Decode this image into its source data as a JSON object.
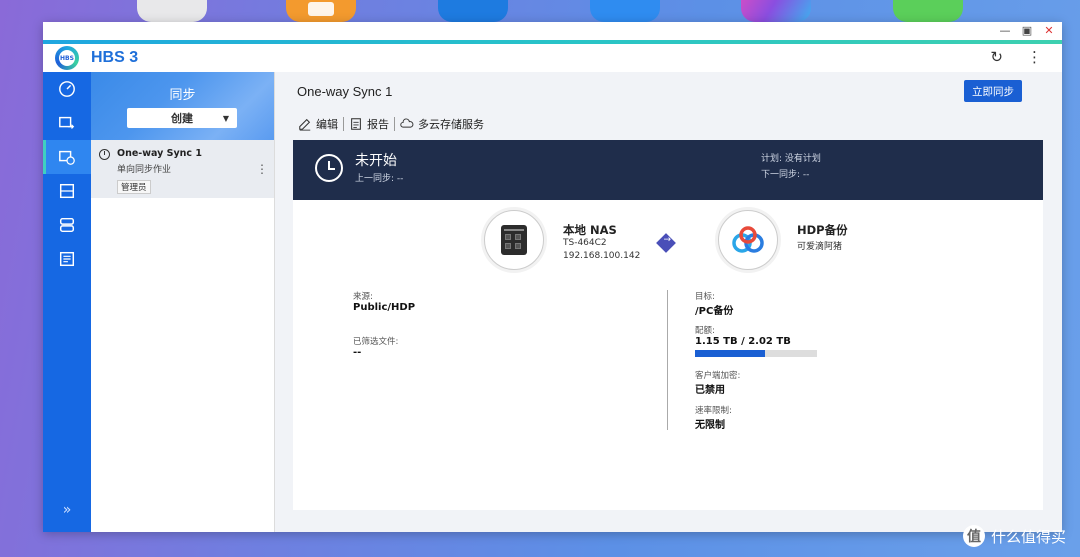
{
  "window": {
    "app_title": "HBS 3",
    "logo_text": "HBS"
  },
  "rail": {
    "items": [
      "overview-icon",
      "backup-icon",
      "sync-icon",
      "restore-icon",
      "storage-icon",
      "logs-icon"
    ],
    "active_index": 2,
    "expand_glyph": "»"
  },
  "list": {
    "header_title": "同步",
    "create_label": "创建",
    "jobs": [
      {
        "name": "One-way Sync 1",
        "type": "单向同步作业",
        "badge": "管理员"
      }
    ]
  },
  "main": {
    "title": "One-way Sync 1",
    "sync_now_label": "立即同步",
    "toolbar": {
      "edit": "编辑",
      "report": "报告",
      "cloud": "多云存储服务"
    },
    "status": {
      "title": "未开始",
      "last_sync": "上一同步: --",
      "plan": "计划: 没有计划",
      "next_sync": "下一同步: --"
    },
    "source_device": {
      "name": "本地 NAS",
      "model": "TS-464C2",
      "ip": "192.168.100.142"
    },
    "target_device": {
      "name": "HDP备份",
      "sub": "可爱滴阿猪"
    },
    "details": {
      "source_label": "来源:",
      "source_value": "Public/HDP",
      "filtered_label": "已筛选文件:",
      "filtered_value": "--",
      "target_label": "目标:",
      "target_value": "/PC备份",
      "quota_label": "配额:",
      "quota_value": "1.15 TB / 2.02 TB",
      "quota_fraction": 0.57,
      "encryption_label": "客户端加密:",
      "encryption_value": "已禁用",
      "rate_label": "速率限制:",
      "rate_value": "无限制"
    }
  },
  "watermark": {
    "glyph": "值",
    "text": "什么值得买"
  },
  "colors": {
    "rail": "#1668e3",
    "primary_button": "#1a5fd3",
    "status_bar": "#1f2d4b"
  }
}
